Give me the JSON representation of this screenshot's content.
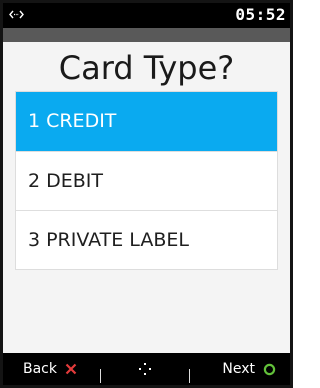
{
  "status_bar": {
    "time": "05:52",
    "connection_icon": "arrows-left-right-icon"
  },
  "title": "Card Type?",
  "options": [
    {
      "number": "1",
      "label": "CREDIT",
      "selected": true
    },
    {
      "number": "2",
      "label": "DEBIT",
      "selected": false
    },
    {
      "number": "3",
      "label": "PRIVATE LABEL",
      "selected": false
    }
  ],
  "bottom_bar": {
    "back_label": "Back",
    "back_icon": "x-cross-icon",
    "center_icon": "move-dots-icon",
    "next_label": "Next",
    "next_icon": "circle-icon"
  },
  "colors": {
    "selected_bg": "#0aaaf0",
    "back_icon": "#e33b3b",
    "next_icon": "#62c13a",
    "band": "#595959"
  }
}
